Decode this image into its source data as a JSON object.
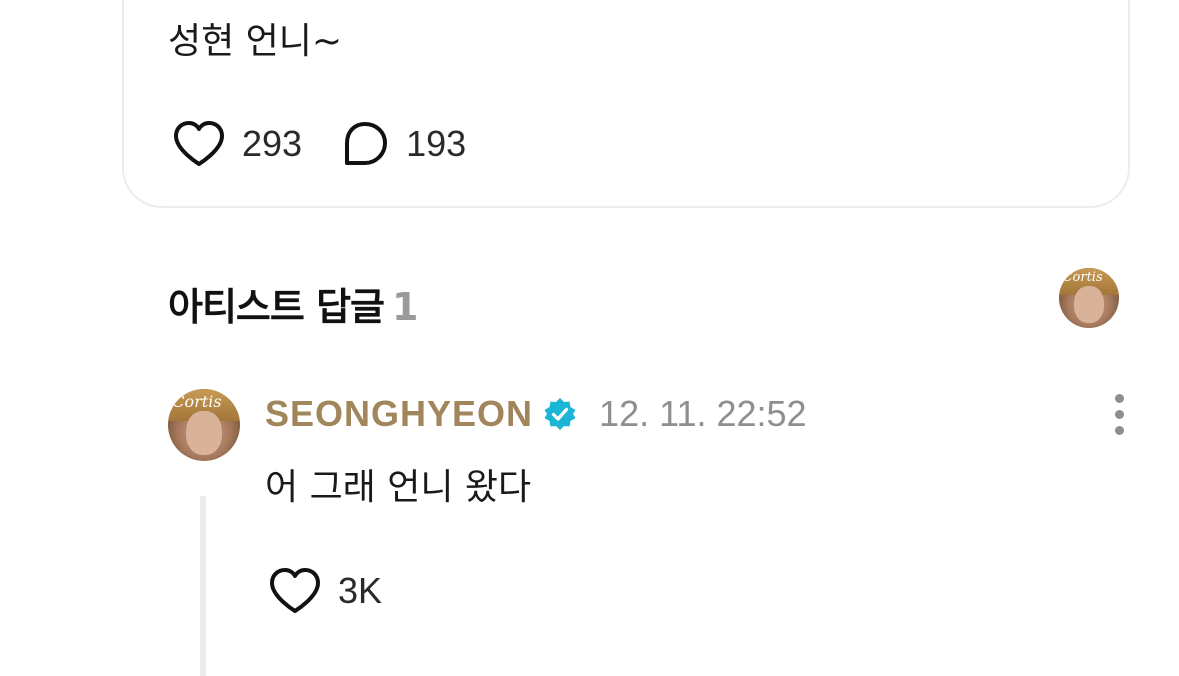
{
  "post": {
    "text": "성현 언니~",
    "likes": "293",
    "comments": "193"
  },
  "artist_replies": {
    "title": "아티스트 답글",
    "count": "1",
    "avatar_logo": "Cortis"
  },
  "reply": {
    "author": "SEONGHYEON",
    "verified_icon": "verified-badge-icon",
    "timestamp": "12. 11. 22:52",
    "text": "어 그래 언니 왔다",
    "likes": "3K",
    "avatar_logo": "Cortis"
  },
  "colors": {
    "author": "#a0865a",
    "verified": "#1bb6d6",
    "muted": "#8e8e93",
    "border": "#ececf0"
  }
}
